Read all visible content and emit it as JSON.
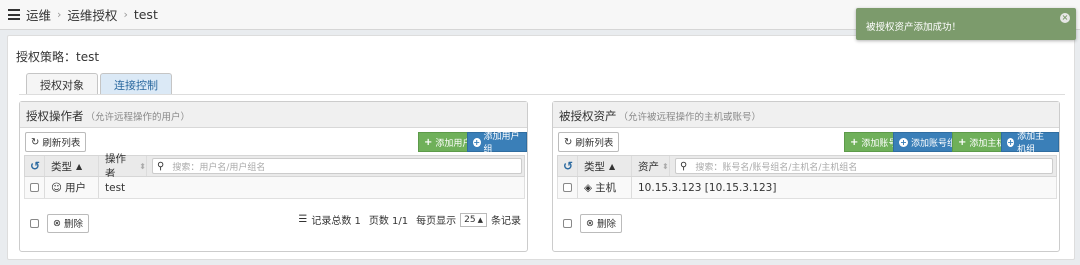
{
  "breadcrumb": {
    "items": [
      "运维",
      "运维授权",
      "test"
    ]
  },
  "toast": {
    "message": "被授权资产添加成功！",
    "close": "×"
  },
  "policy": {
    "label": "授权策略：",
    "name": "test"
  },
  "tabs": [
    {
      "label": "授权对象",
      "active": true
    },
    {
      "label": "连接控制",
      "active": false
    }
  ],
  "left_panel": {
    "title": "授权操作者",
    "subtitle": "（允许远程操作的用户）",
    "refresh_label": "刷新列表",
    "add_user_label": "添加用户",
    "add_user_group_label": "添加用户组",
    "columns": {
      "type": "类型",
      "operator": "操作者"
    },
    "search_placeholder": "搜索：用户名/用户组名",
    "rows": [
      {
        "type": "用户",
        "name": "test"
      }
    ],
    "delete_label": "删除",
    "pager": {
      "total_label": "记录总数 1",
      "pages_label": "页数 1/1",
      "per_page_label": "每页显示",
      "per_page_value": "25",
      "records_suffix": "条记录"
    }
  },
  "right_panel": {
    "title": "被授权资产",
    "subtitle": "（允许被远程操作的主机或账号）",
    "refresh_label": "刷新列表",
    "add_account_label": "添加账号",
    "add_account_group_label": "添加账号组",
    "add_host_label": "添加主机",
    "add_host_group_label": "添加主机组",
    "columns": {
      "type": "类型",
      "asset": "资产"
    },
    "search_placeholder": "搜索：账号名/账号组名/主机名/主机组名",
    "rows": [
      {
        "type": "主机",
        "name": "10.15.3.123 [10.15.3.123]"
      }
    ],
    "delete_label": "删除"
  },
  "colors": {
    "toast_bg": "#7c9b6c",
    "btn_green": "#6fb05a",
    "btn_blue": "#3a7fb8",
    "tab_inactive_bg": "#dbe9f6"
  },
  "icons": [
    "hamburger-icon",
    "refresh-icon",
    "plus-icon",
    "plus-circle-icon",
    "undo-icon",
    "sort-icon",
    "search-icon",
    "user-icon",
    "cube-icon",
    "trash-icon",
    "list-icon"
  ]
}
